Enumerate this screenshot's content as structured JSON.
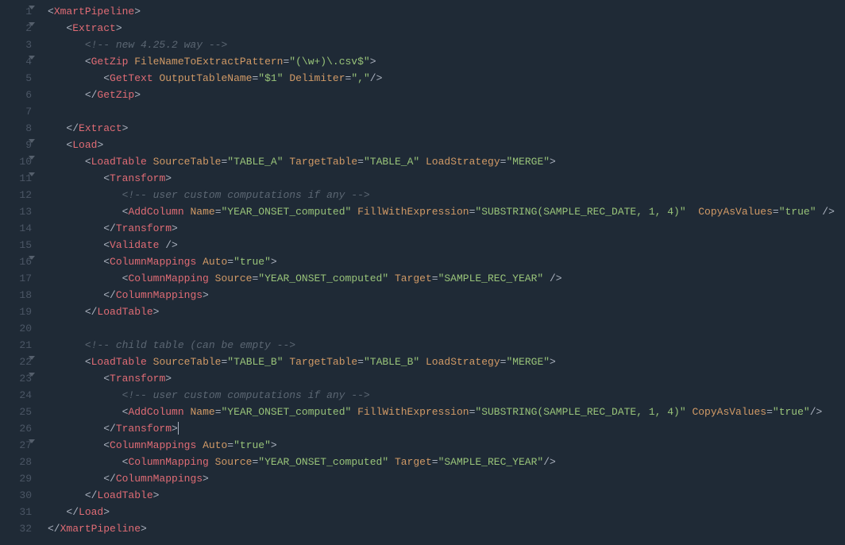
{
  "lines": [
    {
      "num": 1,
      "fold": true,
      "indent": 0,
      "tokens": [
        [
          "punct",
          "<"
        ],
        [
          "tag",
          "XmartPipeline"
        ],
        [
          "punct",
          ">"
        ]
      ]
    },
    {
      "num": 2,
      "fold": true,
      "indent": 1,
      "tokens": [
        [
          "punct",
          "<"
        ],
        [
          "tag",
          "Extract"
        ],
        [
          "punct",
          ">"
        ]
      ]
    },
    {
      "num": 3,
      "fold": false,
      "indent": 2,
      "tokens": [
        [
          "comment",
          "<!-- new 4.25.2 way -->"
        ]
      ]
    },
    {
      "num": 4,
      "fold": true,
      "indent": 2,
      "tokens": [
        [
          "punct",
          "<"
        ],
        [
          "tag",
          "GetZip"
        ],
        [
          "punct",
          " "
        ],
        [
          "attr",
          "FileNameToExtractPattern"
        ],
        [
          "punct",
          "="
        ],
        [
          "str",
          "\"(\\w+)\\.csv$\""
        ],
        [
          "punct",
          ">"
        ]
      ]
    },
    {
      "num": 5,
      "fold": false,
      "indent": 3,
      "tokens": [
        [
          "punct",
          "<"
        ],
        [
          "tag",
          "GetText"
        ],
        [
          "punct",
          " "
        ],
        [
          "attr",
          "OutputTableName"
        ],
        [
          "punct",
          "="
        ],
        [
          "str",
          "\"$1\""
        ],
        [
          "punct",
          " "
        ],
        [
          "attr",
          "Delimiter"
        ],
        [
          "punct",
          "="
        ],
        [
          "str",
          "\",\""
        ],
        [
          "punct",
          "/>"
        ]
      ]
    },
    {
      "num": 6,
      "fold": false,
      "indent": 2,
      "tokens": [
        [
          "punct",
          "</"
        ],
        [
          "tag",
          "GetZip"
        ],
        [
          "punct",
          ">"
        ]
      ]
    },
    {
      "num": 7,
      "fold": false,
      "indent": 0,
      "tokens": []
    },
    {
      "num": 8,
      "fold": false,
      "indent": 1,
      "tokens": [
        [
          "punct",
          "</"
        ],
        [
          "tag",
          "Extract"
        ],
        [
          "punct",
          ">"
        ]
      ]
    },
    {
      "num": 9,
      "fold": true,
      "indent": 1,
      "tokens": [
        [
          "punct",
          "<"
        ],
        [
          "tag",
          "Load"
        ],
        [
          "punct",
          ">"
        ]
      ]
    },
    {
      "num": 10,
      "fold": true,
      "indent": 2,
      "tokens": [
        [
          "punct",
          "<"
        ],
        [
          "tag",
          "LoadTable"
        ],
        [
          "punct",
          " "
        ],
        [
          "attr",
          "SourceTable"
        ],
        [
          "punct",
          "="
        ],
        [
          "str",
          "\"TABLE_A\""
        ],
        [
          "punct",
          " "
        ],
        [
          "attr",
          "TargetTable"
        ],
        [
          "punct",
          "="
        ],
        [
          "str",
          "\"TABLE_A\""
        ],
        [
          "punct",
          " "
        ],
        [
          "attr",
          "LoadStrategy"
        ],
        [
          "punct",
          "="
        ],
        [
          "str",
          "\"MERGE\""
        ],
        [
          "punct",
          ">"
        ]
      ]
    },
    {
      "num": 11,
      "fold": true,
      "indent": 3,
      "tokens": [
        [
          "punct",
          "<"
        ],
        [
          "tag",
          "Transform"
        ],
        [
          "punct",
          ">"
        ]
      ]
    },
    {
      "num": 12,
      "fold": false,
      "indent": 4,
      "tokens": [
        [
          "comment",
          "<!-- user custom computations if any -->"
        ]
      ]
    },
    {
      "num": 13,
      "fold": false,
      "indent": 4,
      "tokens": [
        [
          "punct",
          "<"
        ],
        [
          "tag",
          "AddColumn"
        ],
        [
          "punct",
          " "
        ],
        [
          "attr",
          "Name"
        ],
        [
          "punct",
          "="
        ],
        [
          "str",
          "\"YEAR_ONSET_computed\""
        ],
        [
          "punct",
          " "
        ],
        [
          "attr",
          "FillWithExpression"
        ],
        [
          "punct",
          "="
        ],
        [
          "str",
          "\"SUBSTRING(SAMPLE_REC_DATE, 1, 4)\""
        ],
        [
          "punct",
          "  "
        ],
        [
          "attr",
          "CopyAsValues"
        ],
        [
          "punct",
          "="
        ],
        [
          "str",
          "\"true\""
        ],
        [
          "punct",
          " />"
        ]
      ]
    },
    {
      "num": 14,
      "fold": false,
      "indent": 3,
      "tokens": [
        [
          "punct",
          "</"
        ],
        [
          "tag",
          "Transform"
        ],
        [
          "punct",
          ">"
        ]
      ]
    },
    {
      "num": 15,
      "fold": false,
      "indent": 3,
      "tokens": [
        [
          "punct",
          "<"
        ],
        [
          "tag",
          "Validate"
        ],
        [
          "punct",
          " />"
        ]
      ]
    },
    {
      "num": 16,
      "fold": true,
      "indent": 3,
      "tokens": [
        [
          "punct",
          "<"
        ],
        [
          "tag",
          "ColumnMappings"
        ],
        [
          "punct",
          " "
        ],
        [
          "attr",
          "Auto"
        ],
        [
          "punct",
          "="
        ],
        [
          "str",
          "\"true\""
        ],
        [
          "punct",
          ">"
        ]
      ]
    },
    {
      "num": 17,
      "fold": false,
      "indent": 4,
      "tokens": [
        [
          "punct",
          "<"
        ],
        [
          "tag",
          "ColumnMapping"
        ],
        [
          "punct",
          " "
        ],
        [
          "attr",
          "Source"
        ],
        [
          "punct",
          "="
        ],
        [
          "str",
          "\"YEAR_ONSET_computed\""
        ],
        [
          "punct",
          " "
        ],
        [
          "attr",
          "Target"
        ],
        [
          "punct",
          "="
        ],
        [
          "str",
          "\"SAMPLE_REC_YEAR\""
        ],
        [
          "punct",
          " />"
        ]
      ]
    },
    {
      "num": 18,
      "fold": false,
      "indent": 3,
      "tokens": [
        [
          "punct",
          "</"
        ],
        [
          "tag",
          "ColumnMappings"
        ],
        [
          "punct",
          ">"
        ]
      ]
    },
    {
      "num": 19,
      "fold": false,
      "indent": 2,
      "tokens": [
        [
          "punct",
          "</"
        ],
        [
          "tag",
          "LoadTable"
        ],
        [
          "punct",
          ">"
        ]
      ]
    },
    {
      "num": 20,
      "fold": false,
      "indent": 0,
      "tokens": []
    },
    {
      "num": 21,
      "fold": false,
      "indent": 2,
      "tokens": [
        [
          "comment",
          "<!-- child table (can be empty -->"
        ]
      ]
    },
    {
      "num": 22,
      "fold": true,
      "indent": 2,
      "tokens": [
        [
          "punct",
          "<"
        ],
        [
          "tag",
          "LoadTable"
        ],
        [
          "punct",
          " "
        ],
        [
          "attr",
          "SourceTable"
        ],
        [
          "punct",
          "="
        ],
        [
          "str",
          "\"TABLE_B\""
        ],
        [
          "punct",
          " "
        ],
        [
          "attr",
          "TargetTable"
        ],
        [
          "punct",
          "="
        ],
        [
          "str",
          "\"TABLE_B\""
        ],
        [
          "punct",
          " "
        ],
        [
          "attr",
          "LoadStrategy"
        ],
        [
          "punct",
          "="
        ],
        [
          "str",
          "\"MERGE\""
        ],
        [
          "punct",
          ">"
        ]
      ]
    },
    {
      "num": 23,
      "fold": true,
      "indent": 3,
      "tokens": [
        [
          "punct",
          "<"
        ],
        [
          "tag",
          "Transform"
        ],
        [
          "punct",
          ">"
        ]
      ]
    },
    {
      "num": 24,
      "fold": false,
      "indent": 4,
      "tokens": [
        [
          "comment",
          "<!-- user custom computations if any -->"
        ]
      ]
    },
    {
      "num": 25,
      "fold": false,
      "indent": 4,
      "tokens": [
        [
          "punct",
          "<"
        ],
        [
          "tag",
          "AddColumn"
        ],
        [
          "punct",
          " "
        ],
        [
          "attr",
          "Name"
        ],
        [
          "punct",
          "="
        ],
        [
          "str",
          "\"YEAR_ONSET_computed\""
        ],
        [
          "punct",
          " "
        ],
        [
          "attr",
          "FillWithExpression"
        ],
        [
          "punct",
          "="
        ],
        [
          "str",
          "\"SUBSTRING(SAMPLE_REC_DATE, 1, 4)\""
        ],
        [
          "punct",
          " "
        ],
        [
          "attr",
          "CopyAsValues"
        ],
        [
          "punct",
          "="
        ],
        [
          "str",
          "\"true\""
        ],
        [
          "punct",
          "/>"
        ]
      ]
    },
    {
      "num": 26,
      "fold": false,
      "indent": 3,
      "cursor": true,
      "tokens": [
        [
          "punct",
          "</"
        ],
        [
          "tag",
          "Transform"
        ],
        [
          "punct",
          ">"
        ]
      ]
    },
    {
      "num": 27,
      "fold": true,
      "indent": 3,
      "tokens": [
        [
          "punct",
          "<"
        ],
        [
          "tag",
          "ColumnMappings"
        ],
        [
          "punct",
          " "
        ],
        [
          "attr",
          "Auto"
        ],
        [
          "punct",
          "="
        ],
        [
          "str",
          "\"true\""
        ],
        [
          "punct",
          ">"
        ]
      ]
    },
    {
      "num": 28,
      "fold": false,
      "indent": 4,
      "tokens": [
        [
          "punct",
          "<"
        ],
        [
          "tag",
          "ColumnMapping"
        ],
        [
          "punct",
          " "
        ],
        [
          "attr",
          "Source"
        ],
        [
          "punct",
          "="
        ],
        [
          "str",
          "\"YEAR_ONSET_computed\""
        ],
        [
          "punct",
          " "
        ],
        [
          "attr",
          "Target"
        ],
        [
          "punct",
          "="
        ],
        [
          "str",
          "\"SAMPLE_REC_YEAR\""
        ],
        [
          "punct",
          "/>"
        ]
      ]
    },
    {
      "num": 29,
      "fold": false,
      "indent": 3,
      "tokens": [
        [
          "punct",
          "</"
        ],
        [
          "tag",
          "ColumnMappings"
        ],
        [
          "punct",
          ">"
        ]
      ]
    },
    {
      "num": 30,
      "fold": false,
      "indent": 2,
      "tokens": [
        [
          "punct",
          "</"
        ],
        [
          "tag",
          "LoadTable"
        ],
        [
          "punct",
          ">"
        ]
      ]
    },
    {
      "num": 31,
      "fold": false,
      "indent": 1,
      "tokens": [
        [
          "punct",
          "</"
        ],
        [
          "tag",
          "Load"
        ],
        [
          "punct",
          ">"
        ]
      ]
    },
    {
      "num": 32,
      "fold": false,
      "indent": 0,
      "tokens": [
        [
          "punct",
          "</"
        ],
        [
          "tag",
          "XmartPipeline"
        ],
        [
          "punct",
          ">"
        ]
      ]
    }
  ],
  "indent_unit": "   ",
  "colors": {
    "background": "#1f2a36",
    "tag": "#e06c75",
    "attr": "#d19a66",
    "string": "#98c379",
    "punct": "#abb2bf",
    "comment": "#5c6773",
    "gutter": "#4b5665"
  }
}
